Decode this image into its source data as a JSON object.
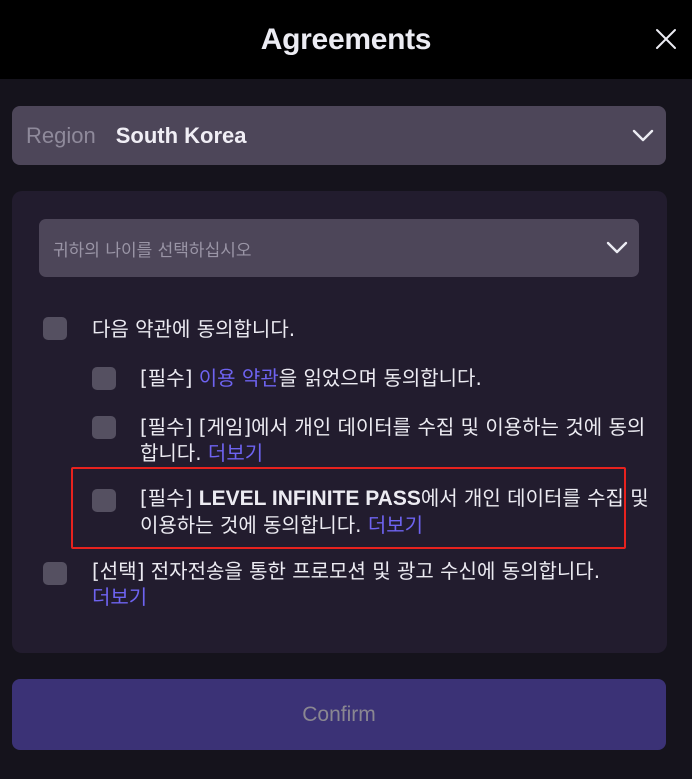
{
  "header": {
    "title": "Agreements",
    "close_icon": "close-icon"
  },
  "region": {
    "label": "Region",
    "value": "South Korea",
    "icon": "chevron-down-icon"
  },
  "age": {
    "placeholder": "귀하의 나이를 선택하십시오",
    "icon": "chevron-down-icon"
  },
  "agreements": {
    "all": {
      "checked": false,
      "text": "다음 약관에 동의합니다."
    },
    "terms_of_service": {
      "checked": false,
      "prefix": "[필수] ",
      "link": "이용 약관",
      "suffix": "을 읽었으며 동의합니다."
    },
    "game_data": {
      "checked": false,
      "text": "[필수] [게임]에서 개인 데이터를 수집 및 이용하는 것에 동의합니다. ",
      "link": "더보기"
    },
    "level_infinite_pass": {
      "checked": false,
      "prefix": "[필수] ",
      "bold": "LEVEL INFINITE PASS",
      "text": "에서 개인 데이터를 수집 및 이용하는 것에 동의합니다. ",
      "link": "더보기",
      "highlighted": true
    },
    "promotions": {
      "checked": false,
      "text": "[선택] 전자전송을 통한 프로모션 및 광고 수신에 동의합니다. ",
      "link": "더보기"
    }
  },
  "confirm": {
    "label": "Confirm",
    "enabled": false
  },
  "colors": {
    "accent_link": "#6e63f0",
    "confirm_bg": "#3b3276",
    "highlight_border": "#e8221e",
    "select_bg": "#4d4659",
    "panel_bg": "#221c2e"
  }
}
